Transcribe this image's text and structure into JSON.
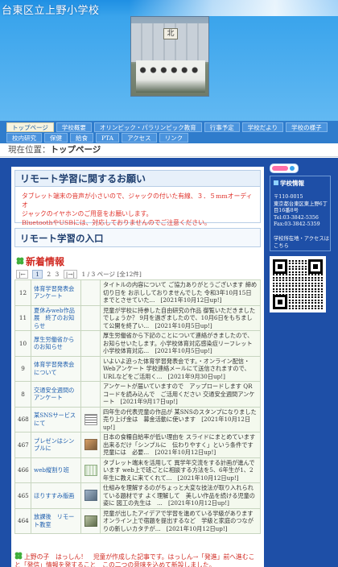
{
  "site": {
    "title": "台東区立上野小学校",
    "photo_sign": "北"
  },
  "nav": {
    "row1": [
      "トップページ",
      "学校概要",
      "オリンピック・パラリンピック教育",
      "行事予定",
      "学校だより",
      "学校の様子"
    ],
    "row2": [
      "校内研究",
      "保健",
      "給食",
      "PTA",
      "アクセス",
      "リンク"
    ],
    "active": "トップページ"
  },
  "breadcrumb": {
    "prefix": "現在位置：",
    "current": "トップページ"
  },
  "notice": {
    "title": "リモート学習に関するお願い",
    "lines": [
      "タブレット端末の音声が小さいので、ジャックの付いた有線、３．５mmオーディオ",
      "ジャックのイヤホンのご用意をお願いします。",
      "BluetoothやUSBには、対応しておりませんのでご注意ください。"
    ]
  },
  "entrance": {
    "title": "リモート学習の入口"
  },
  "news": {
    "title": "新着情報",
    "pager": {
      "first": "|←",
      "pages": [
        "1",
        "2",
        "3"
      ],
      "last": "|→|",
      "summary": "1 / 3 ページ [全12件]"
    },
    "rows": [
      {
        "num": "12",
        "title": "体育学習発表会　アンケート",
        "thumb": "",
        "desc": "タイトルの内容について ご協力ありがとうございます 締め切り日を お示ししておりませんでした 令和3年10月15日 までとさせていた...　[2021年10月12日up!]"
      },
      {
        "num": "11",
        "title": "夏休みweb作品展　終了のお知らせ",
        "thumb": "",
        "desc": "児童が学校に持参した自由研究の作品 御覧いただきましたでしょうか？ 9月を過ぎましたので、10月6日をもちまして公開を終了い...　[2021年10月5日up!]"
      },
      {
        "num": "10",
        "title": "厚生労働省からのお知らせ",
        "thumb": "",
        "desc": "厚生労働省から下記のことについて連絡がきましたので、お知らせいたします。小学校体育対応感染症リーフレット 小学校体育対応...　[2021年10月5日up!]"
      },
      {
        "num": "9",
        "title": "体育学習発表会について",
        "thumb": "",
        "desc": "いよいよ迫った体育学習発表会です。・オンライン配信・Webアンケート 学校連絡メールにて送信されますので、URLなどをご活用く...　[2021年9月30日up!]"
      },
      {
        "num": "8",
        "title": "交通安全週間のアンケート",
        "thumb": "",
        "desc": "アンケートが届いていますので　アップロードします QRコードを読み込んで　ご活用ください 交通安全週間アンケート　[2021年9月17日up!]"
      },
      {
        "num": "468",
        "title": "某SNSサービスにて",
        "thumb": "t-doc",
        "desc": "四年生の代表児童の作品が 某SNSのスタンプになりました 売り上げ金は　募金活動に使います　[2021年10月12日up!]"
      },
      {
        "num": "467",
        "title": "プレゼンはシンプルに",
        "thumb": "t-photo1",
        "desc": "日本の食糧自給率が低い理由を スライドにまとめています 出来るだけ「シンプルに　伝わりやすく」という条件です 児童には　必要...　[2021年10月12日up!]"
      },
      {
        "num": "466",
        "title": "web縦割り班",
        "thumb": "t-grid",
        "desc": "タブレット端末を活用して 異学年交流をする計画が進んでいます web上で班ごとに相談する方法を5、6年生が1、2年生に教えに来てくれて...　[2021年10月12日up!]"
      },
      {
        "num": "465",
        "title": "ほりすすみ版画",
        "thumb": "t-photo2",
        "desc": "仕組みを理解するのがちょっと大変な技法が取り入れられている題材です よく理解して　美しい作品を続ける児童の姿に 図工の先生は　...　[2021年10月12日up!]"
      },
      {
        "num": "464",
        "title": "放課後　リモート教室",
        "thumb": "t-photo3",
        "desc": "児童が出したアイデアで学習を進めている学級があります オンライン上で宿題を提出するなど　学級と家庭のつながりの新しいカタチが...　[2021年10月12日up!]"
      }
    ]
  },
  "bottom_note": "上野の子　はっしん！　児童が作成した記事です。はっしん→「発進」前へ進むこと「発信」情報を発すること　この二つの意味を込めて新設しました。",
  "sidebar": {
    "title": "学校情報",
    "address_lines": [
      "〒110-0015",
      "東京都台東区東上野6丁目16番8号",
      "Tel:03-3842-5356",
      "Fax:03-3842-5359"
    ],
    "link": "学校所在地・アクセスはこちら"
  },
  "colors": {
    "header_blue": "#3aa4ec",
    "main_blue": "#1e4fa7",
    "accent_red": "#d12a22",
    "link_blue": "#1f5fae"
  }
}
